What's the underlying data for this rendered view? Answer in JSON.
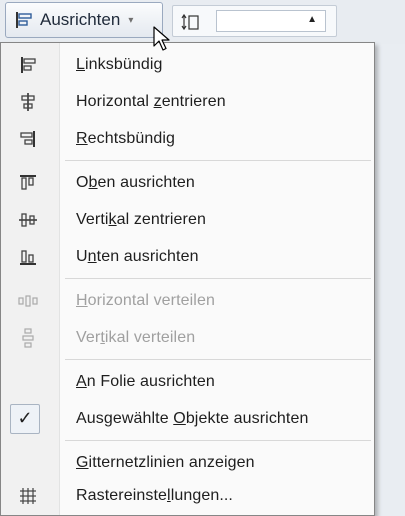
{
  "ribbon": {
    "button_label": "Ausrichten",
    "caret": "▾",
    "size_arrow": "▲"
  },
  "menu": {
    "items": [
      {
        "pre": "",
        "key": "L",
        "post": "inksbündig",
        "icon": "align-left-icon",
        "enabled": true
      },
      {
        "pre": "Horizontal ",
        "key": "z",
        "post": "entrieren",
        "icon": "align-center-icon",
        "enabled": true
      },
      {
        "pre": "",
        "key": "R",
        "post": "echtsbündig",
        "icon": "align-right-icon",
        "enabled": true
      },
      {
        "pre": "O",
        "key": "b",
        "post": "en ausrichten",
        "icon": "align-top-icon",
        "enabled": true
      },
      {
        "pre": "Verti",
        "key": "k",
        "post": "al zentrieren",
        "icon": "align-middle-icon",
        "enabled": true
      },
      {
        "pre": "U",
        "key": "n",
        "post": "ten ausrichten",
        "icon": "align-bottom-icon",
        "enabled": true
      },
      {
        "pre": "",
        "key": "H",
        "post": "orizontal verteilen",
        "icon": "distribute-horizontal-icon",
        "enabled": false
      },
      {
        "pre": "Ver",
        "key": "t",
        "post": "ikal verteilen",
        "icon": "distribute-vertical-icon",
        "enabled": false
      },
      {
        "pre": "",
        "key": "A",
        "post": "n Folie ausrichten",
        "icon": "",
        "enabled": true
      },
      {
        "pre": "Ausgewählte ",
        "key": "O",
        "post": "bjekte ausrichten",
        "icon": "checkmark-icon",
        "check": "✓",
        "enabled": true
      },
      {
        "pre": "",
        "key": "G",
        "post": "itternetzlinien anzeigen",
        "icon": "",
        "enabled": true
      },
      {
        "pre": "Rastereinste",
        "key": "l",
        "post": "lungen...",
        "icon": "grid-icon",
        "enabled": true
      }
    ]
  }
}
